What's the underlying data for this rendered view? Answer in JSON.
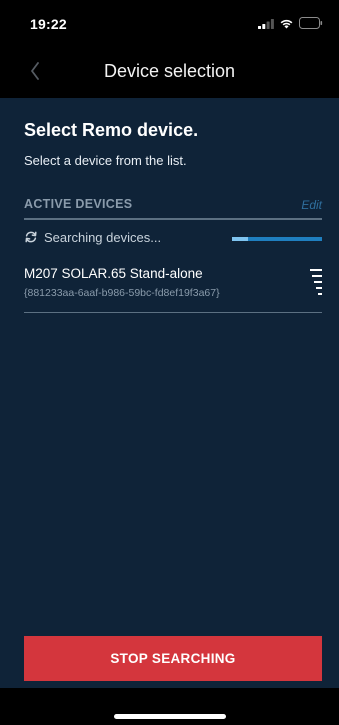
{
  "status_bar": {
    "time": "19:22",
    "icons": [
      "cellular-signal-icon",
      "wifi-icon",
      "battery-icon"
    ]
  },
  "nav": {
    "back_icon": "chevron-left-icon",
    "title": "Device selection"
  },
  "main": {
    "heading": "Select Remo device.",
    "subheading": "Select a device from the list.",
    "section": {
      "title": "ACTIVE DEVICES",
      "edit_label": "Edit"
    },
    "searching": {
      "icon": "refresh-icon",
      "label": "Searching devices...",
      "progress_fraction": 0.18
    },
    "devices": [
      {
        "name": "M207 SOLAR.65 Stand-alone",
        "id": "{881233aa-6aaf-b986-59bc-fd8ef19f3a67}",
        "icon": "signal-strength-icon"
      }
    ]
  },
  "footer": {
    "stop_label": "STOP SEARCHING"
  },
  "colors": {
    "background": "#0f2338",
    "accent_red": "#d4363d",
    "progress_blue": "#1f7fbf",
    "muted_text": "#8a9bab",
    "edit_link": "#2f6f9e"
  }
}
